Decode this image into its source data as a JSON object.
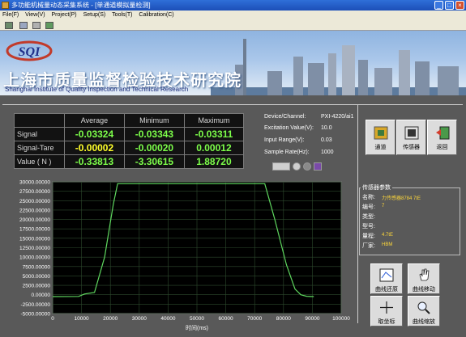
{
  "window": {
    "title": "多功能机械量动态采集系统 - [单通道模拟量检测]",
    "controls": [
      "_",
      "□",
      "×"
    ]
  },
  "menu": [
    "File(F)",
    "View(V)",
    "Project(P)",
    "Setup(S)",
    "Tools(T)",
    "Calibration(C)"
  ],
  "banner": {
    "cn_title": "上海市质量监督检验技术研究院",
    "en_title": "Shanghai  Institute of Quality Inspection and Technical Research",
    "logo_text": "SQI"
  },
  "stats": {
    "headers": [
      "",
      "Average",
      "Minimum",
      "Maximum"
    ],
    "rows": [
      {
        "label": "Signal",
        "values": [
          "-0.03324",
          "-0.03343",
          "-0.03311"
        ],
        "colors": [
          "#7dff4a",
          "#7dff4a",
          "#7dff4a"
        ]
      },
      {
        "label": "Signal-Tare",
        "values": [
          "-0.00002",
          "-0.00020",
          "0.00012"
        ],
        "colors": [
          "#ffff2a",
          "#7dff4a",
          "#7dff4a"
        ]
      },
      {
        "label": "Value ( N )",
        "values": [
          "-0.33813",
          "-3.30615",
          "1.88720"
        ],
        "colors": [
          "#7dff4a",
          "#7dff4a",
          "#7dff4a"
        ]
      }
    ]
  },
  "device": {
    "channel_label": "Device/Channel:",
    "channel": "PXI-4220/ai1",
    "excitation_label": "Excitation Value(V):",
    "excitation": "10.0",
    "range_label": "Input Range(V):",
    "range": "0.03",
    "rate_label": "Sample Rate(Hz):",
    "rate": "1000"
  },
  "buttons": {
    "channel": "通道",
    "sensor": "传感器",
    "back": "返回",
    "restore": "曲线还原",
    "move": "曲线移动",
    "cursor": "取坐标",
    "zoom": "曲线缩放"
  },
  "sensor": {
    "title": "传感器参数",
    "name_label": "名称:",
    "name": "力传感器8784 7tE",
    "id_label": "编号:",
    "id": "7",
    "type_label": "类型:",
    "type": "",
    "model_label": "型号:",
    "model": "",
    "range_label": "量程:",
    "range": "4.7tE",
    "maker_label": "厂家:",
    "maker": "HBM"
  },
  "colors": {
    "accent_green": "#7dff4a",
    "accent_yellow": "#ffff2a",
    "plot_bg": "#000000",
    "curve": "#5fd85f"
  },
  "chart_data": {
    "type": "line",
    "xlabel": "时间(ms)",
    "ylabel": "",
    "xlim": [
      0,
      100000
    ],
    "ylim": [
      -5000,
      30000
    ],
    "x_ticks": [
      "0",
      "10000",
      "20000",
      "30000",
      "40000",
      "50000",
      "60000",
      "70000",
      "80000",
      "90000",
      "100000"
    ],
    "y_ticks": [
      "-5000.00000",
      "-2500.00000",
      "0.00000",
      "2500.00000",
      "5000.00000",
      "7500.00000",
      "10000.00000",
      "12500.00000",
      "15000.00000",
      "17500.00000",
      "20000.00000",
      "22500.00000",
      "25000.00000",
      "27500.00000",
      "30000.00000"
    ],
    "grid": true,
    "series": [
      {
        "x": [
          0,
          9000,
          11000,
          14500,
          18000,
          21000,
          22500,
          25000,
          72000,
          73500,
          77000,
          81000,
          84000,
          86000,
          88000,
          90500
        ],
        "y": [
          -500,
          -450,
          200,
          600,
          10000,
          24000,
          29500,
          29500,
          29500,
          29500,
          20000,
          8000,
          1500,
          0,
          -400,
          -500
        ]
      }
    ]
  }
}
